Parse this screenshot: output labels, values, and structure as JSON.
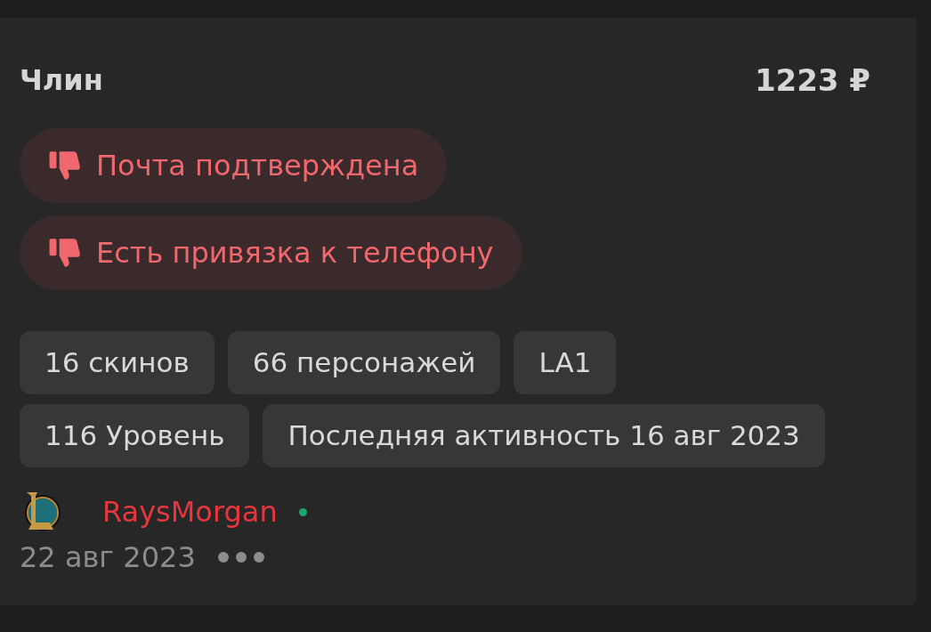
{
  "title": "Члин",
  "price": "1223 ₽",
  "checks": [
    {
      "label": "Почта подтверждена",
      "ok": false
    },
    {
      "label": "Есть привязка к телефону",
      "ok": false
    }
  ],
  "tags": [
    [
      "16 скинов",
      "66 персонажей",
      "LA1"
    ],
    [
      "116 Уровень",
      "Последняя активность 16 авг 2023"
    ]
  ],
  "seller": {
    "name": "RaysMorgan",
    "online": true
  },
  "date": "22 авг 2023"
}
